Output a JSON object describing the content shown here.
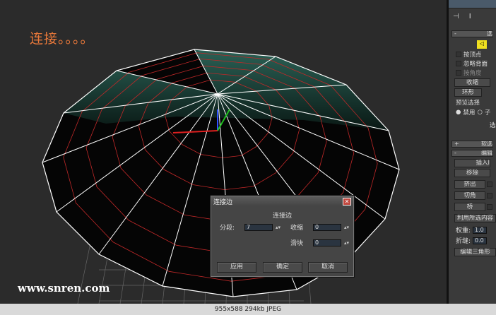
{
  "viewport": {
    "caption": "连接。。。。",
    "watermark": "www.snren.com"
  },
  "panel": {
    "rollout_select": "选",
    "checkboxes": [
      "按顶点",
      "忽略背面",
      "按角度"
    ],
    "shrink": "收缩",
    "ring": "环形",
    "preview_label": "预览选择",
    "preview_off": "禁用",
    "preview_sub": "子",
    "select_label": "选",
    "soft_select": "软选",
    "edit": "编辑",
    "insert": "插入I",
    "remove": "移除",
    "extrude": "挤出",
    "chamfer": "切角",
    "bridge": "桥",
    "use_selected": "利用所选内容",
    "weight_label": "权重:",
    "weight_value": "1.0",
    "crease_label": "折缝:",
    "crease_value": "0.0",
    "edit_tri": "编辑三角形"
  },
  "dialog": {
    "title": "连接边",
    "heading": "连接边",
    "segments_label": "分段:",
    "segments_value": "7",
    "pinch_label": "收缩",
    "pinch_value": "0",
    "slide_label": "滑块",
    "slide_value": "0",
    "apply": "应用",
    "ok": "确定",
    "cancel": "取消"
  },
  "status": "955x588 294kb JPEG"
}
